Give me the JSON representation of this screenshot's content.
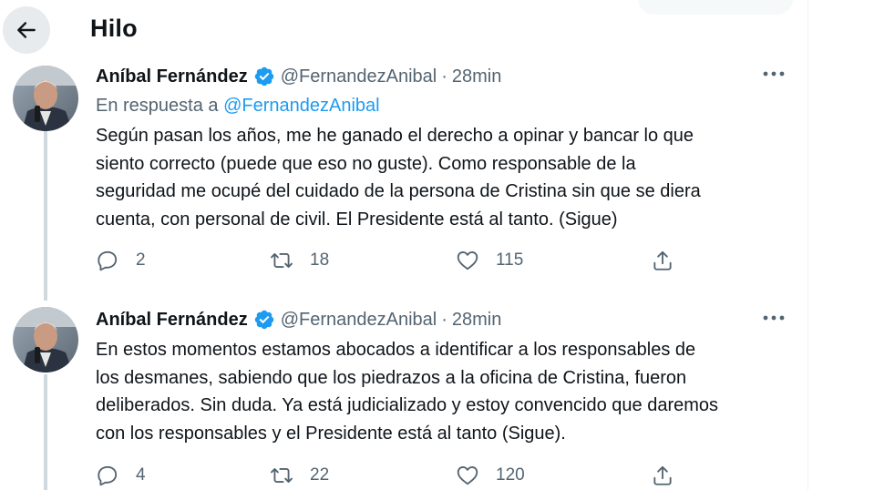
{
  "header": {
    "title": "Hilo"
  },
  "colors": {
    "accent": "#1d9bf0",
    "text": "#0f1419",
    "muted": "#536471",
    "thread_line": "#cfd9de"
  },
  "tweets": [
    {
      "author_name": "Aníbal Fernández",
      "handle": "@FernandezAnibal",
      "separator": "·",
      "time": "28min",
      "reply_prefix": "En respuesta a",
      "reply_handle": "@FernandezAnibal",
      "text_lines": [
        "Según pasan los años, me he ganado el derecho a opinar y bancar lo que",
        "siento correcto (puede que eso no guste). Como responsable de la",
        "seguridad me ocupé del cuidado de la persona de Cristina sin que se diera",
        "cuenta, con personal de civil. El Presidente está al tanto. (Sigue)"
      ],
      "replies": "2",
      "retweets": "18",
      "likes": "115"
    },
    {
      "author_name": "Aníbal Fernández",
      "handle": "@FernandezAnibal",
      "separator": "·",
      "time": "28min",
      "text_lines": [
        "En estos momentos estamos abocados a identificar a los responsables de",
        "los desmanes, sabiendo que los piedrazos a la oficina de Cristina, fueron",
        "deliberados. Sin duda. Ya está judicializado y estoy convencido que daremos",
        "con los responsables y el Presidente está al tanto (Sigue)."
      ],
      "replies": "4",
      "retweets": "22",
      "likes": "120"
    }
  ],
  "icons": {
    "back": "arrow-left-icon",
    "verified": "verified-badge-icon",
    "more": "more-dots-icon",
    "reply": "reply-bubble-icon",
    "retweet": "retweet-icon",
    "like": "heart-icon",
    "share": "share-upload-icon"
  }
}
